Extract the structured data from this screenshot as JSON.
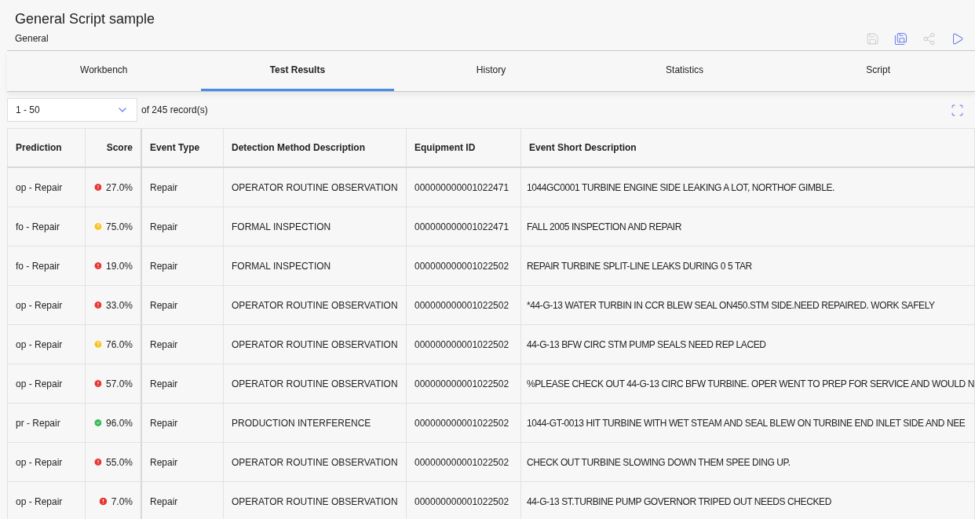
{
  "header": {
    "title": "General Script sample",
    "subtitle": "General"
  },
  "toolbar": [
    {
      "kind": "save",
      "disabled": true
    },
    {
      "kind": "save-as",
      "disabled": false
    },
    {
      "kind": "share",
      "disabled": true
    },
    {
      "kind": "run",
      "disabled": false
    }
  ],
  "tabs": [
    {
      "label": "Workbench",
      "selected": false
    },
    {
      "label": "Test Results",
      "selected": true
    },
    {
      "label": "History",
      "selected": false
    },
    {
      "label": "Statistics",
      "selected": false
    },
    {
      "label": "Script",
      "selected": false
    }
  ],
  "pager": {
    "range": "1 - 50",
    "total": "of 245 record(s)"
  },
  "table": {
    "columns": [
      "Prediction",
      "Score",
      "Event Type",
      "Detection Method Description",
      "Equipment ID",
      "Event Short Description"
    ],
    "rows": [
      {
        "prediction": "op - Repair",
        "kind": "error",
        "color": "#e53935",
        "score": "27.0%",
        "event_type": "Repair",
        "method": "OPERATOR ROUTINE OBSERVATION",
        "equipment": "000000000001022471",
        "description": "1044GC0001 TURBINE ENGINE SIDE LEAKING A LOT, NORTHOF GIMBLE."
      },
      {
        "prediction": "fo - Repair",
        "kind": "warning",
        "color": "#f9c022",
        "score": "75.0%",
        "event_type": "Repair",
        "method": "FORMAL INSPECTION",
        "equipment": "000000000001022471",
        "description": "FALL 2005 INSPECTION AND REPAIR"
      },
      {
        "prediction": "fo - Repair",
        "kind": "error",
        "color": "#e53935",
        "score": "19.0%",
        "event_type": "Repair",
        "method": "FORMAL INSPECTION",
        "equipment": "000000000001022502",
        "description": "REPAIR TURBINE SPLIT-LINE LEAKS DURING 0 5 TAR"
      },
      {
        "prediction": "op - Repair",
        "kind": "error",
        "color": "#e53935",
        "score": "33.0%",
        "event_type": "Repair",
        "method": "OPERATOR ROUTINE OBSERVATION",
        "equipment": "000000000001022502",
        "description": "*44-G-13 WATER TURBIN IN CCR BLEW SEAL ON450.STM SIDE.NEED REPAIRED. WORK SAFELY"
      },
      {
        "prediction": "op - Repair",
        "kind": "warning",
        "color": "#f9c022",
        "score": "76.0%",
        "event_type": "Repair",
        "method": "OPERATOR ROUTINE OBSERVATION",
        "equipment": "000000000001022502",
        "description": "44-G-13 BFW CIRC STM PUMP SEALS NEED REP LACED"
      },
      {
        "prediction": "op - Repair",
        "kind": "error",
        "color": "#e53935",
        "score": "57.0%",
        "event_type": "Repair",
        "method": "OPERATOR ROUTINE OBSERVATION",
        "equipment": "000000000001022502",
        "description": "%PLEASE CHECK OUT 44-G-13 CIRC BFW TURBINE. OPER WENT TO PREP FOR SERVICE AND WOULD N"
      },
      {
        "prediction": "pr - Repair",
        "kind": "ok",
        "color": "#3cb95a",
        "score": "96.0%",
        "event_type": "Repair",
        "method": "PRODUCTION INTERFERENCE",
        "equipment": "000000000001022502",
        "description": "1044-GT-0013 HIT TURBINE WITH WET STEAM AND SEAL BLEW ON TURBINE END INLET SIDE AND NEE"
      },
      {
        "prediction": "op - Repair",
        "kind": "error",
        "color": "#e53935",
        "score": "55.0%",
        "event_type": "Repair",
        "method": "OPERATOR ROUTINE OBSERVATION",
        "equipment": "000000000001022502",
        "description": "CHECK OUT TURBINE SLOWING DOWN THEM SPEE DING UP."
      },
      {
        "prediction": "op - Repair",
        "kind": "error",
        "color": "#e53935",
        "score": "7.0%",
        "event_type": "Repair",
        "method": "OPERATOR ROUTINE OBSERVATION",
        "equipment": "000000000001022502",
        "description": "44-G-13 ST.TURBINE PUMP GOVERNOR TRIPED OUT NEEDS CHECKED"
      }
    ]
  }
}
